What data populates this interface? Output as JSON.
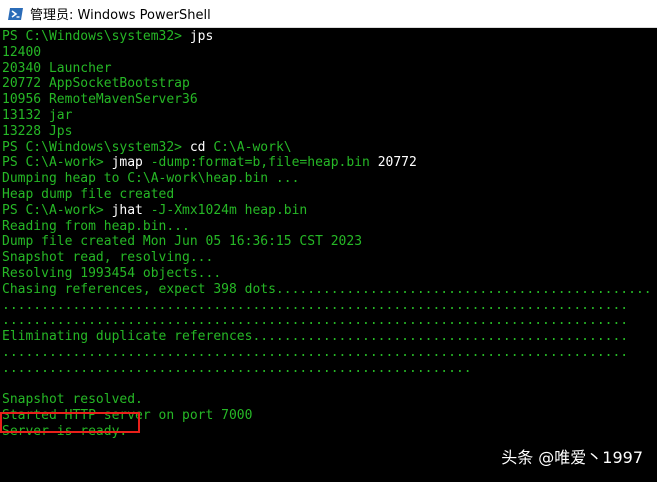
{
  "window": {
    "title": "管理员: Windows PowerShell",
    "icon": "powershell-icon"
  },
  "colors": {
    "background": "#000000",
    "prompt": "#26b826",
    "command": "#ffffff",
    "argument": "#26b826",
    "output": "#26b826",
    "highlight_border": "#e8201a"
  },
  "console": {
    "lines": [
      [
        {
          "t": "PS C:\\Windows\\system32> ",
          "c": "prompt"
        },
        {
          "t": "jps",
          "c": "command"
        }
      ],
      [
        {
          "t": "12400",
          "c": "output"
        }
      ],
      [
        {
          "t": "20340 Launcher",
          "c": "output"
        }
      ],
      [
        {
          "t": "20772 AppSocketBootstrap",
          "c": "output"
        }
      ],
      [
        {
          "t": "10956 RemoteMavenServer36",
          "c": "output"
        }
      ],
      [
        {
          "t": "13132 jar",
          "c": "output"
        }
      ],
      [
        {
          "t": "13228 Jps",
          "c": "output"
        }
      ],
      [
        {
          "t": "PS C:\\Windows\\system32> ",
          "c": "prompt"
        },
        {
          "t": "cd ",
          "c": "command"
        },
        {
          "t": "C:\\A-work\\",
          "c": "argument"
        }
      ],
      [
        {
          "t": "PS C:\\A-work> ",
          "c": "prompt"
        },
        {
          "t": "jmap ",
          "c": "command"
        },
        {
          "t": "-dump:format=b,file=heap.bin ",
          "c": "argument"
        },
        {
          "t": "20772",
          "c": "command"
        }
      ],
      [
        {
          "t": "Dumping heap to C:\\A-work\\heap.bin ...",
          "c": "output"
        }
      ],
      [
        {
          "t": "Heap dump file created",
          "c": "output"
        }
      ],
      [
        {
          "t": "PS C:\\A-work> ",
          "c": "prompt"
        },
        {
          "t": "jhat ",
          "c": "command"
        },
        {
          "t": "-J-Xmx1024m heap.bin",
          "c": "argument"
        }
      ],
      [
        {
          "t": "Reading from heap.bin...",
          "c": "output"
        }
      ],
      [
        {
          "t": "Dump file created Mon Jun 05 16:36:15 CST 2023",
          "c": "output"
        }
      ],
      [
        {
          "t": "Snapshot read, resolving...",
          "c": "output"
        }
      ],
      [
        {
          "t": "Resolving 1993454 objects...",
          "c": "output"
        }
      ],
      [
        {
          "t": "Chasing references, expect 398 dots................................................",
          "c": "output"
        }
      ],
      [
        {
          "t": "................................................................................",
          "c": "output"
        }
      ],
      [
        {
          "t": "................................................................................",
          "c": "output"
        }
      ],
      [
        {
          "t": "Eliminating duplicate references................................................",
          "c": "output"
        }
      ],
      [
        {
          "t": "................................................................................",
          "c": "output"
        }
      ],
      [
        {
          "t": "............................................................",
          "c": "output"
        }
      ],
      [
        {
          "t": "",
          "c": "output"
        }
      ],
      [
        {
          "t": "Snapshot resolved.",
          "c": "output"
        }
      ],
      [
        {
          "t": "Started HTTP server on port 7000",
          "c": "output"
        }
      ],
      [
        {
          "t": "Server is ready.",
          "c": "output"
        }
      ]
    ]
  },
  "watermark": {
    "text": "头条 @唯爱丶1997"
  }
}
